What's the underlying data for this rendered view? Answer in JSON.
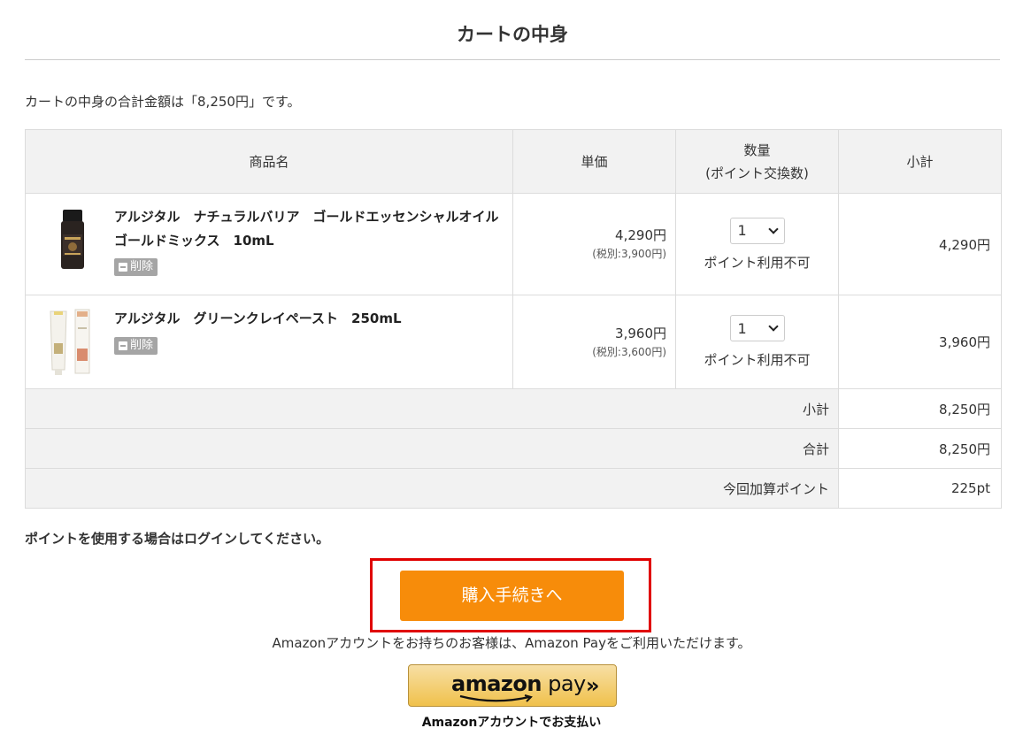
{
  "title": "カートの中身",
  "summary": "カートの中身の合計金額は「8,250円」です。",
  "table": {
    "headers": {
      "product": "商品名",
      "unit_price": "単価",
      "qty_line1": "数量",
      "qty_line2": "(ポイント交換数)",
      "subtotal": "小計"
    },
    "items": [
      {
        "name": "アルジタル　ナチュラルバリア　ゴールドエッセンシャルオイル　ゴールドミックス　10mL",
        "delete_label": "削除",
        "price": "4,290円",
        "price_tax": "(税別:3,900円)",
        "qty": "1",
        "qty_note": "ポイント利用不可",
        "subtotal": "4,290円"
      },
      {
        "name": "アルジタル　グリーンクレイペースト　250mL",
        "delete_label": "削除",
        "price": "3,960円",
        "price_tax": "(税別:3,600円)",
        "qty": "1",
        "qty_note": "ポイント利用不可",
        "subtotal": "3,960円"
      }
    ],
    "totals": [
      {
        "label": "小計",
        "value": "8,250円"
      },
      {
        "label": "合計",
        "value": "8,250円"
      },
      {
        "label": "今回加算ポイント",
        "value": "225pt"
      }
    ]
  },
  "login_note": "ポイントを使用する場合はログインしてください。",
  "checkout_label": "購入手続きへ",
  "amazon": {
    "note": "Amazonアカウントをお持ちのお客様は、Amazon Payをご利用いただけます。",
    "logo_amazon": "amazon",
    "logo_pay": " pay",
    "chevrons": "»",
    "sub_label": "Amazonアカウントでお支払い"
  },
  "colors": {
    "checkout": "#f78c0a",
    "highlight": "#e00000",
    "header_bg": "#f2f2f2",
    "amazon_gold": "#f0c14b"
  }
}
